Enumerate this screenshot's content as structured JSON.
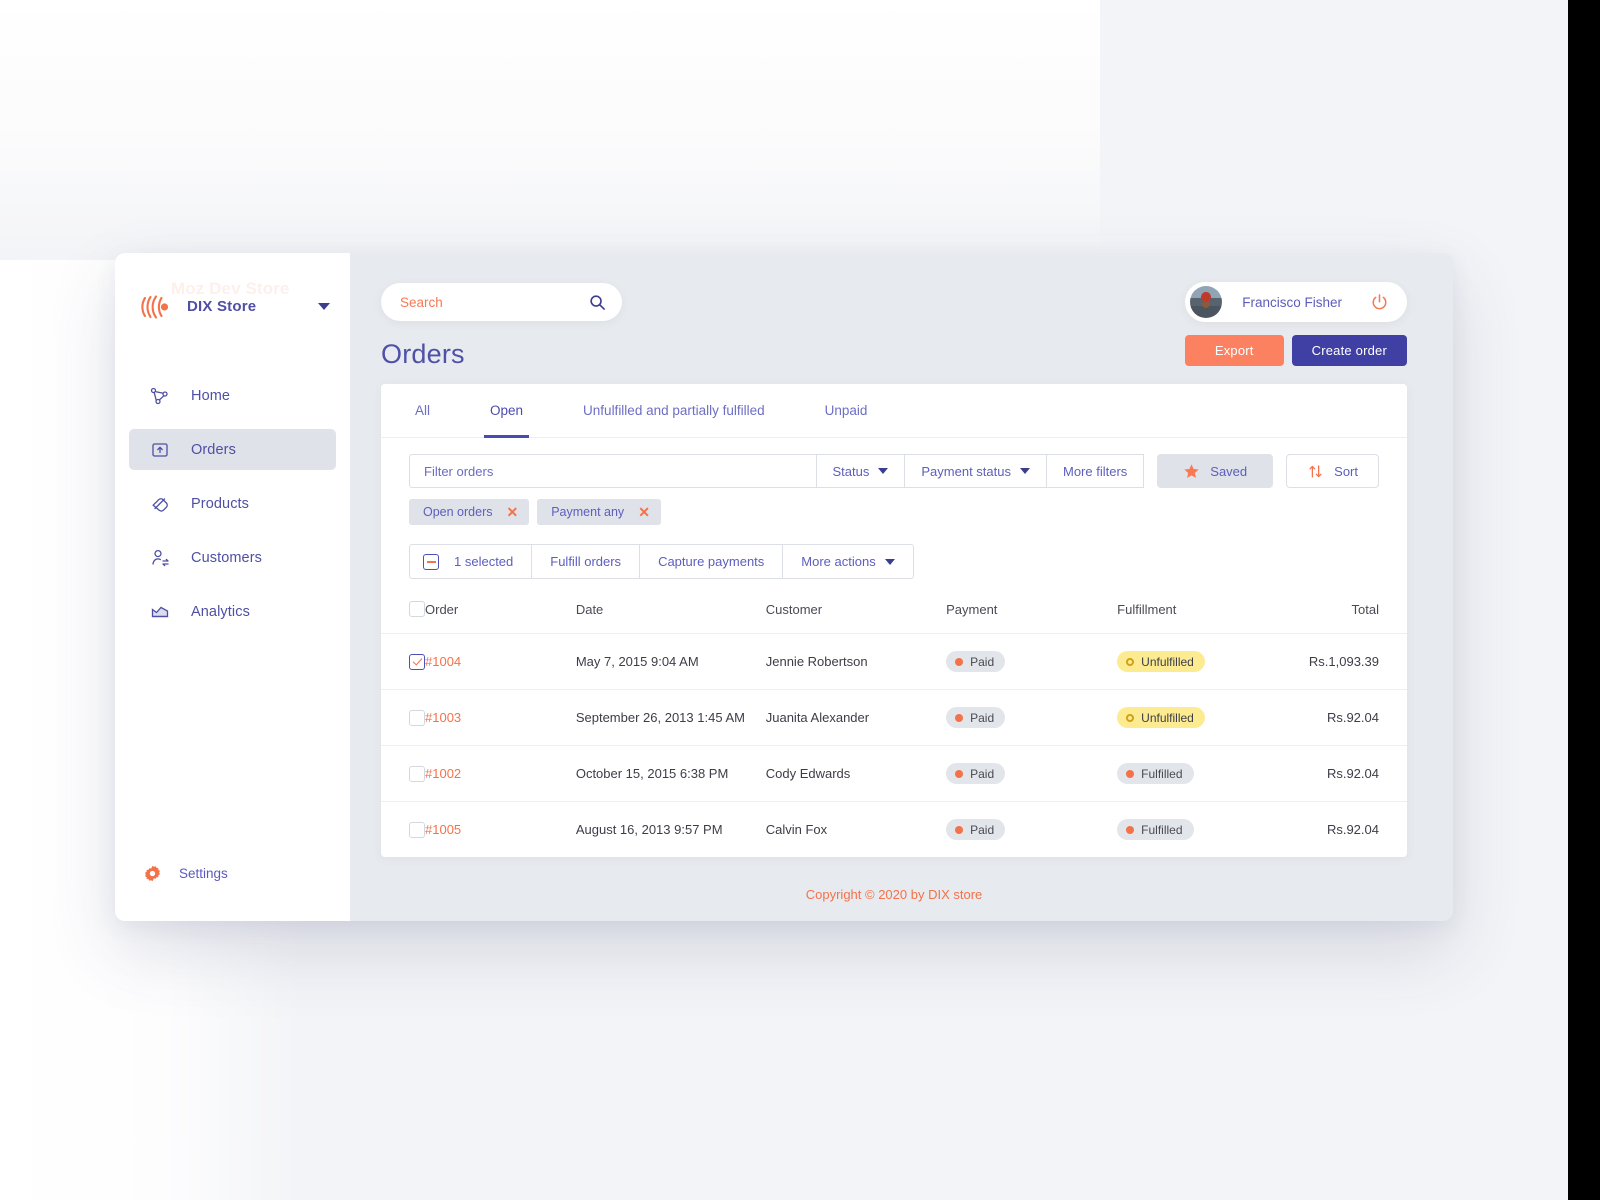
{
  "brand": {
    "name": "DIX Store",
    "watermark": "Moz Dev Store",
    "logo_icon": "signal-waves-icon",
    "caret_icon": "chevron-down-icon"
  },
  "sidebar": {
    "items": [
      {
        "label": "Home",
        "icon": "network-nodes-icon",
        "active": false
      },
      {
        "label": "Orders",
        "icon": "order-box-icon",
        "active": true
      },
      {
        "label": "Products",
        "icon": "tag-icon",
        "active": false
      },
      {
        "label": "Customers",
        "icon": "user-exchange-icon",
        "active": false
      },
      {
        "label": "Analytics",
        "icon": "chart-area-icon",
        "active": false
      }
    ],
    "settings": {
      "label": "Settings",
      "icon": "gear-icon"
    }
  },
  "topbar": {
    "search": {
      "placeholder": "Search",
      "value": "",
      "icon": "search-icon"
    },
    "user": {
      "name": "Francisco Fisher",
      "avatar": "user-avatar",
      "logout_icon": "power-icon"
    }
  },
  "header": {
    "title": "Orders",
    "export_label": "Export",
    "create_label": "Create order"
  },
  "tabs": [
    {
      "label": "All",
      "active": false
    },
    {
      "label": "Open",
      "active": true
    },
    {
      "label": "Unfulfilled and partially fulfilled",
      "active": false
    },
    {
      "label": "Unpaid",
      "active": false
    }
  ],
  "filters": {
    "input_placeholder": "Filter orders",
    "input_value": "",
    "status_label": "Status",
    "payment_status_label": "Payment status",
    "more_filters_label": "More filters",
    "saved_label": "Saved",
    "saved_icon": "star-icon",
    "sort_label": "Sort",
    "sort_icon": "sort-arrows-icon",
    "chips": [
      {
        "label": "Open orders",
        "remove_icon": "close-icon"
      },
      {
        "label": "Payment any",
        "remove_icon": "close-icon"
      }
    ]
  },
  "action_bar": {
    "selected_label": "1 selected",
    "fulfill_label": "Fulfill orders",
    "capture_label": "Capture payments",
    "more_actions_label": "More actions"
  },
  "table": {
    "columns": [
      "Order",
      "Date",
      "Customer",
      "Payment",
      "Fulfillment",
      "Total"
    ],
    "rows": [
      {
        "selected": true,
        "order": "#1004",
        "date": "May 7, 2015 9:04 AM",
        "customer": "Jennie Robertson",
        "payment": "Paid",
        "payment_style": "gray",
        "fulfillment": "Unfulfilled",
        "fulfillment_style": "yellow",
        "total": "Rs.1,093.39"
      },
      {
        "selected": false,
        "order": "#1003",
        "date": "September 26, 2013 1:45 AM",
        "customer": "Juanita Alexander",
        "payment": "Paid",
        "payment_style": "gray",
        "fulfillment": "Unfulfilled",
        "fulfillment_style": "yellow",
        "total": "Rs.92.04"
      },
      {
        "selected": false,
        "order": "#1002",
        "date": "October 15, 2015 6:38 PM",
        "customer": "Cody Edwards",
        "payment": "Paid",
        "payment_style": "gray",
        "fulfillment": "Fulfilled",
        "fulfillment_style": "gray",
        "total": "Rs.92.04"
      },
      {
        "selected": false,
        "order": "#1005",
        "date": "August 16, 2013 9:57 PM",
        "customer": "Calvin Fox",
        "payment": "Paid",
        "payment_style": "gray",
        "fulfillment": "Fulfilled",
        "fulfillment_style": "gray",
        "total": "Rs.92.04"
      }
    ]
  },
  "footer": {
    "copyright": "Copyright © 2020 by DIX store"
  },
  "colors": {
    "accent_orange": "#f4724a",
    "accent_indigo": "#4f51a8",
    "brand_indigo": "#3f3fa4",
    "badge_yellow": "#fdeb92",
    "badge_gray": "#e2e5ea",
    "sidebar_active": "#dfe2e8",
    "app_bg": "#e7eaee"
  }
}
